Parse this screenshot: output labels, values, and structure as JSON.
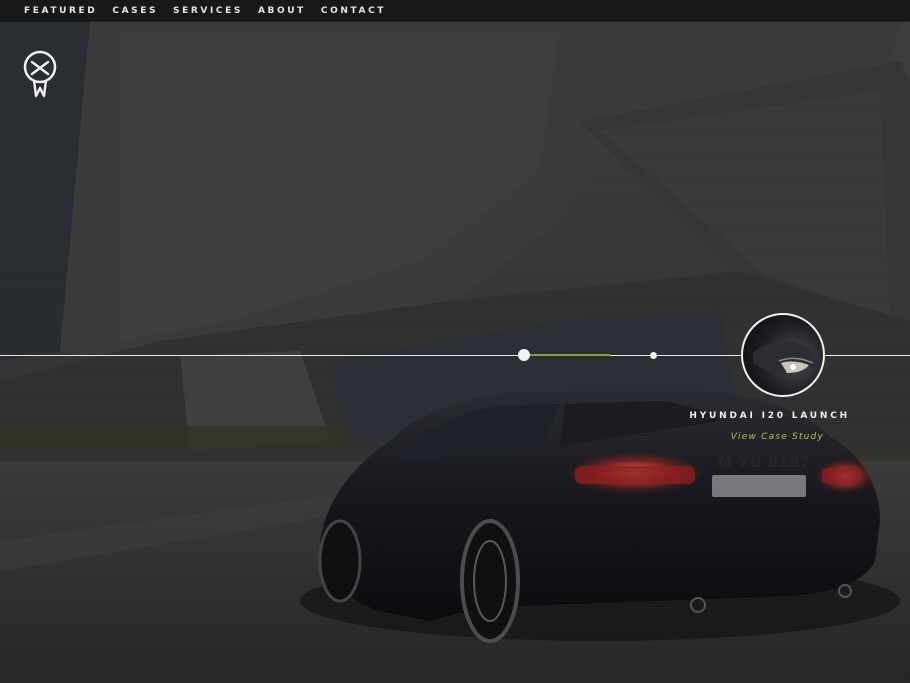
{
  "nav": {
    "items": [
      {
        "label": "FEATURED"
      },
      {
        "label": "CASES"
      },
      {
        "label": "SERVICES"
      },
      {
        "label": "ABOUT"
      },
      {
        "label": "CONTACT"
      }
    ]
  },
  "logo": {
    "icon": "skull-logo-icon"
  },
  "hero": {
    "background": "dark car night photo",
    "license_plate": "M YU 8197"
  },
  "timeline": {
    "progress": 0.4,
    "accent_color": "#8fa12a"
  },
  "feature_case": {
    "title": "HYUNDAI I20 LAUNCH",
    "link_label": "View Case Study",
    "link_color": "#b7c832"
  }
}
